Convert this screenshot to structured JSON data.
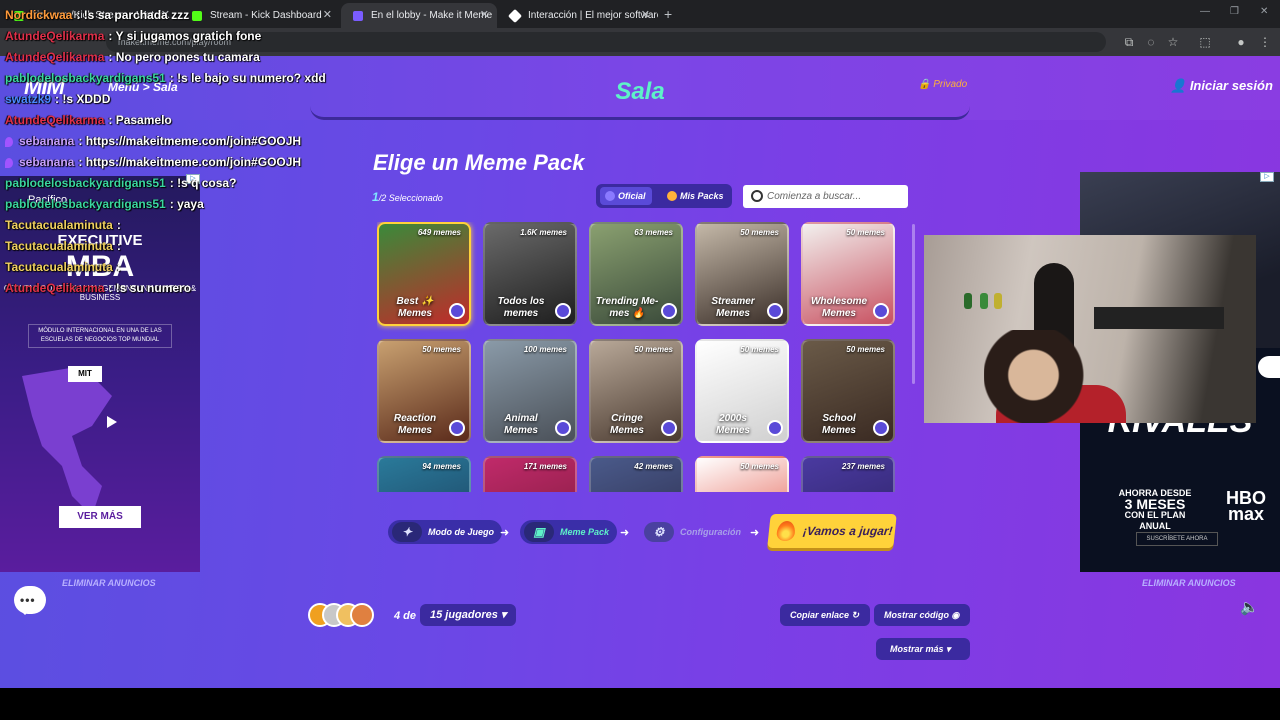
{
  "browser": {
    "tabs": [
      {
        "title": "kick.com/Kick Stream - Watch...",
        "active": false,
        "color": "#53fc18"
      },
      {
        "title": "Stream - Kick Dashboard",
        "active": false,
        "color": "#53fc18"
      },
      {
        "title": "En el lobby - Make it Meme",
        "active": true,
        "color": "#7a5cff"
      },
      {
        "title": "Interacción | El mejor software p",
        "active": false,
        "color": "#ffffff"
      }
    ],
    "address": "makeitmeme.com/play/room"
  },
  "header": {
    "logo": "MIM",
    "menu_link": "Menú > Sala",
    "title": "Sala",
    "privacy": "Privado",
    "login": "Iniciar sesión"
  },
  "main": {
    "title": "Elige un Meme Pack",
    "selected_count": "1",
    "selected_suffix": "/2 Seleccionado",
    "filter_official": "Oficial",
    "filter_mine": "Mis Packs",
    "search_placeholder": "Comienza a buscar..."
  },
  "packs": [
    {
      "name": "Best ✨ Memes",
      "count": "649 memes",
      "selected": true,
      "c1": "#3a8a3a",
      "c2": "#c22a2a"
    },
    {
      "name": "Todos los memes",
      "count": "1.6K memes",
      "selected": false,
      "c1": "#6a6a6a",
      "c2": "#1e1e1e"
    },
    {
      "name": "Trending Me- mes 🔥",
      "count": "63 memes",
      "selected": false,
      "c1": "#8aa070",
      "c2": "#3a4a3a"
    },
    {
      "name": "Streamer Memes",
      "count": "50 memes",
      "selected": false,
      "c1": "#c4b8a8",
      "c2": "#3a2e28"
    },
    {
      "name": "Wholesome Memes",
      "count": "50 memes",
      "selected": false,
      "c1": "#f2f0ee",
      "c2": "#c85060"
    },
    {
      "name": "Reaction Memes",
      "count": "50 memes",
      "selected": false,
      "c1": "#c8a070",
      "c2": "#5a2a1a"
    },
    {
      "name": "Animal Memes",
      "count": "100 memes",
      "selected": false,
      "c1": "#8a9aa8",
      "c2": "#4a5058"
    },
    {
      "name": "Cringe Memes",
      "count": "50 memes",
      "selected": false,
      "c1": "#b8a898",
      "c2": "#4a3a30"
    },
    {
      "name": "2000s Memes",
      "count": "50 memes",
      "selected": false,
      "c1": "#ffffff",
      "c2": "#d0d0d0"
    },
    {
      "name": "School Memes",
      "count": "50 memes",
      "selected": false,
      "c1": "#6a5a48",
      "c2": "#3a2a22"
    },
    {
      "name": "",
      "count": "94 memes",
      "selected": false,
      "c1": "#2a7a9a",
      "c2": "#1a3a5a"
    },
    {
      "name": "",
      "count": "171 memes",
      "selected": false,
      "c1": "#c02a6a",
      "c2": "#7a1a3a"
    },
    {
      "name": "",
      "count": "42 memes",
      "selected": false,
      "c1": "#4a5a8a",
      "c2": "#2a2a4a"
    },
    {
      "name": "",
      "count": "50 memes",
      "selected": false,
      "c1": "#ffffff",
      "c2": "#e04a3a"
    },
    {
      "name": "",
      "count": "237 memes",
      "selected": false,
      "c1": "#4a3aa0",
      "c2": "#2a2060"
    }
  ],
  "steps": {
    "mode": "Modo de Juego",
    "pack": "Meme Pack",
    "config": "Configuración",
    "play": "¡Vamos a jugar!"
  },
  "ads": {
    "remove_left": "ELIMINAR ANUNCIOS",
    "remove_right": "ELIMINAR ANUNCIOS",
    "left": {
      "brand": "Pacífico",
      "exec": "EXECUTIVE",
      "mba": "MBA",
      "enfoque": "CON ENFOQUE EN MANAGEMENT, INNOVATION & BUSINESS",
      "modulo": "MÓDULO INTERNACIONAL EN UNA DE LAS ESCUELAS DE NEGOCIOS TOP MUNDIAL",
      "mit": "MIT",
      "cta": "VER MÁS"
    },
    "right": {
      "rivales": "RIVALES",
      "ahorra": "AHORRA DESDE",
      "meses": "3 MESES",
      "plan": "CON EL PLAN ANUAL",
      "brand": "HBO max",
      "cta": "SUSCRÍBETE AHORA"
    }
  },
  "bottom": {
    "players_current": "4 de",
    "players_max": "15 jugadores",
    "copy_link": "Copiar enlace",
    "show_code": "Mostrar código",
    "show_more": "Mostrar más"
  },
  "chat": [
    {
      "user": "Nordickwaa",
      "text": ": !s sa parchada zzz",
      "color": "#ff9a3a",
      "badge": false
    },
    {
      "user": "AtundeQelikarma",
      "text": ": Y si jugamos gratich fone",
      "color": "#e0304a",
      "badge": false
    },
    {
      "user": "AtundeQelikarma",
      "text": ": No pero pones tu camara",
      "color": "#e0304a",
      "badge": false
    },
    {
      "user": "pablodelosbackyardigans51",
      "text": ": !s le bajo su numero? xdd",
      "color": "#3ad6a0",
      "badge": false
    },
    {
      "user": "swatzk9",
      "text": ": !s XDDD",
      "color": "#4a8aff",
      "badge": false
    },
    {
      "user": "AtundeQelikarma",
      "text": ": Pasamelo",
      "color": "#e0304a",
      "badge": false
    },
    {
      "user": "sebanana",
      "text": ": https://makeitmeme.com/join#GOOJH",
      "color": "#c8a0ff",
      "badge": true
    },
    {
      "user": "sebanana",
      "text": ": https://makeitmeme.com/join#GOOJH",
      "color": "#c8a0ff",
      "badge": true
    },
    {
      "user": "pablodelosbackyardigans51",
      "text": ": !s q cosa?",
      "color": "#3ad6a0",
      "badge": false
    },
    {
      "user": "pablodelosbackyardigans51",
      "text": ": yaya",
      "color": "#3ad6a0",
      "badge": false
    },
    {
      "user": "Tacutacualaminuta",
      "text": ":",
      "color": "#f0d060",
      "badge": false
    },
    {
      "user": "Tacutacualaminuta",
      "text": ":",
      "color": "#f0d060",
      "badge": false
    },
    {
      "user": "Tacutacualaminuta",
      "text": ":",
      "color": "#f0d060",
      "badge": false
    },
    {
      "user": "AtundeQelikarma",
      "text": ": !s su numero",
      "color": "#e0304a",
      "badge": false
    }
  ]
}
